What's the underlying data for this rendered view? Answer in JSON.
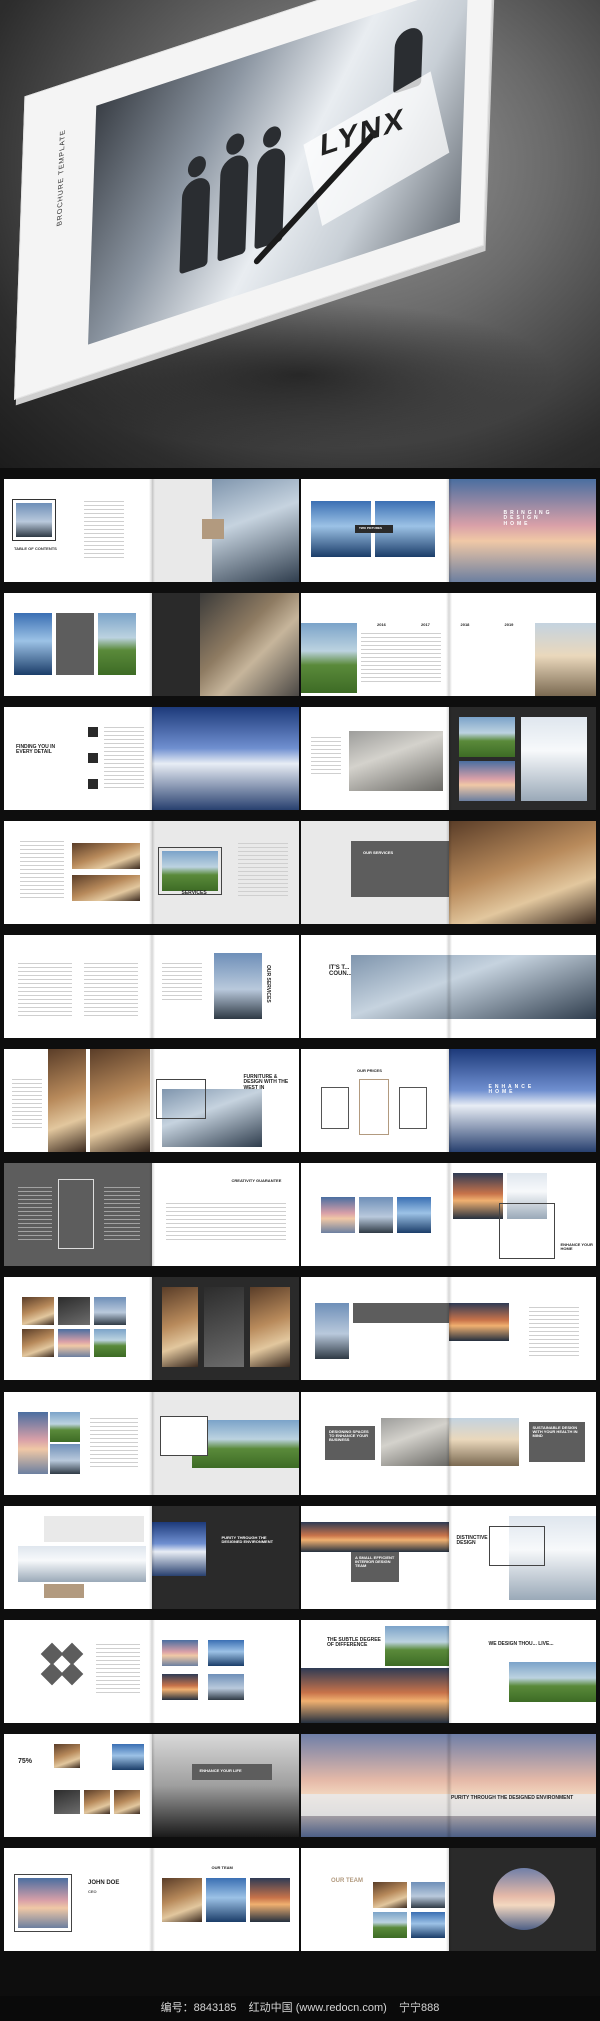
{
  "cover": {
    "template_label": "BROCHURE TEMPLATE",
    "logo_text": "LYNX"
  },
  "spreads": {
    "toc_label": "TABLE OF CONTENTS",
    "two_pictures": "TWO PICTURES",
    "bringing_design_home": "BRINGING DESIGN HOME",
    "years": [
      "2016",
      "2017",
      "2018",
      "2019"
    ],
    "finding_you": "FINDING YOU IN EVERY DETAIL",
    "services": "SERVICES",
    "our_services": "OUR SERVICES",
    "its_inside": "IT'S T... INSIDE TH... COUN...",
    "our_prices": "OUR PRICES",
    "furniture": "FURNITURE & DESIGN WITH THE WEST IN",
    "enhance_home": "ENHANCE HOME",
    "creativity": "CREATIVITY GUARANTEE",
    "enhance_your_home": "ENHANCE YOUR HOME",
    "designing_spaces": "DESIGNING SPACES TO ENHANCE YOUR BUSINESS",
    "sustainable": "SUSTAINABLE DESIGN WITH YOUR HEALTH IN MIND",
    "purity_designed": "PURITY THROUGH THE DESIGNED ENVIRONMENT",
    "small_efficient": "A SMALL EFFICIENT INTERIOR DESIGN TEAM",
    "distinctive": "DISTINCTIVE DESIGN",
    "subtle_degree": "THE SUBTLE DEGREE OF DIFFERENCE",
    "we_design": "WE DESIGN THOU... LIVE...",
    "percent": "75%",
    "enhance_your_life": "ENHANCE YOUR LIFE",
    "purity_through": "PURITY THROUGH THE DESIGNED ENVIRONMENT",
    "john_doe": "JOHN DOE",
    "ceo": "CEO",
    "our_team": "OUR TEAM",
    "our_team_2": "OUR TEAM"
  },
  "watermark": {
    "id_text": "编号：8843185",
    "site_text": "红动中国 (www.redocn.com)",
    "user_text": "宁宁888"
  }
}
